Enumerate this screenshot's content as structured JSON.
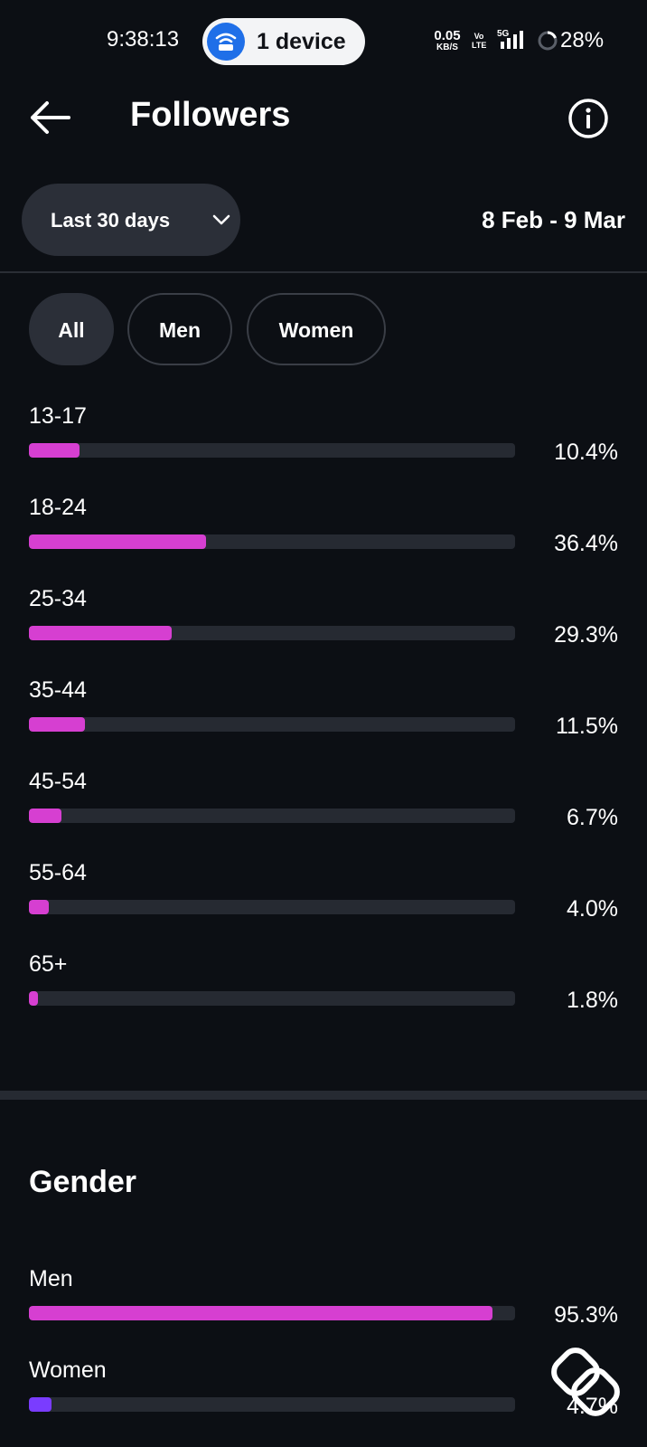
{
  "status_bar": {
    "time": "9:38:13",
    "hotspot_label": "1 device",
    "net_speed_value": "0.05",
    "net_speed_unit": "KB/S",
    "volte_top": "Vo",
    "volte_bottom": "LTE",
    "network_type": "5G",
    "battery": "28%"
  },
  "header": {
    "title": "Followers",
    "back_icon": "arrow-left-icon",
    "info_icon": "info-icon"
  },
  "filters": {
    "range_label": "Last 30 days",
    "date_range": "8 Feb - 9 Mar",
    "chips": [
      "All",
      "Men",
      "Women"
    ],
    "selected_chip": "All"
  },
  "colors": {
    "accent": "#d63fd1",
    "secondary": "#7a3cff",
    "track": "#262a32",
    "background": "#0c0f14"
  },
  "age_groups": [
    {
      "label": "13-17",
      "value_text": "10.4%",
      "percent": 10.4
    },
    {
      "label": "18-24",
      "value_text": "36.4%",
      "percent": 36.4
    },
    {
      "label": "25-34",
      "value_text": "29.3%",
      "percent": 29.3
    },
    {
      "label": "35-44",
      "value_text": "11.5%",
      "percent": 11.5
    },
    {
      "label": "45-54",
      "value_text": "6.7%",
      "percent": 6.7
    },
    {
      "label": "55-64",
      "value_text": "4.0%",
      "percent": 4.0
    },
    {
      "label": "65+",
      "value_text": "1.8%",
      "percent": 1.8
    }
  ],
  "gender": {
    "title": "Gender",
    "rows": [
      {
        "label": "Men",
        "value_text": "95.3%",
        "percent": 95.3
      },
      {
        "label": "Women",
        "value_text": "4.7%",
        "percent": 4.7
      }
    ]
  }
}
